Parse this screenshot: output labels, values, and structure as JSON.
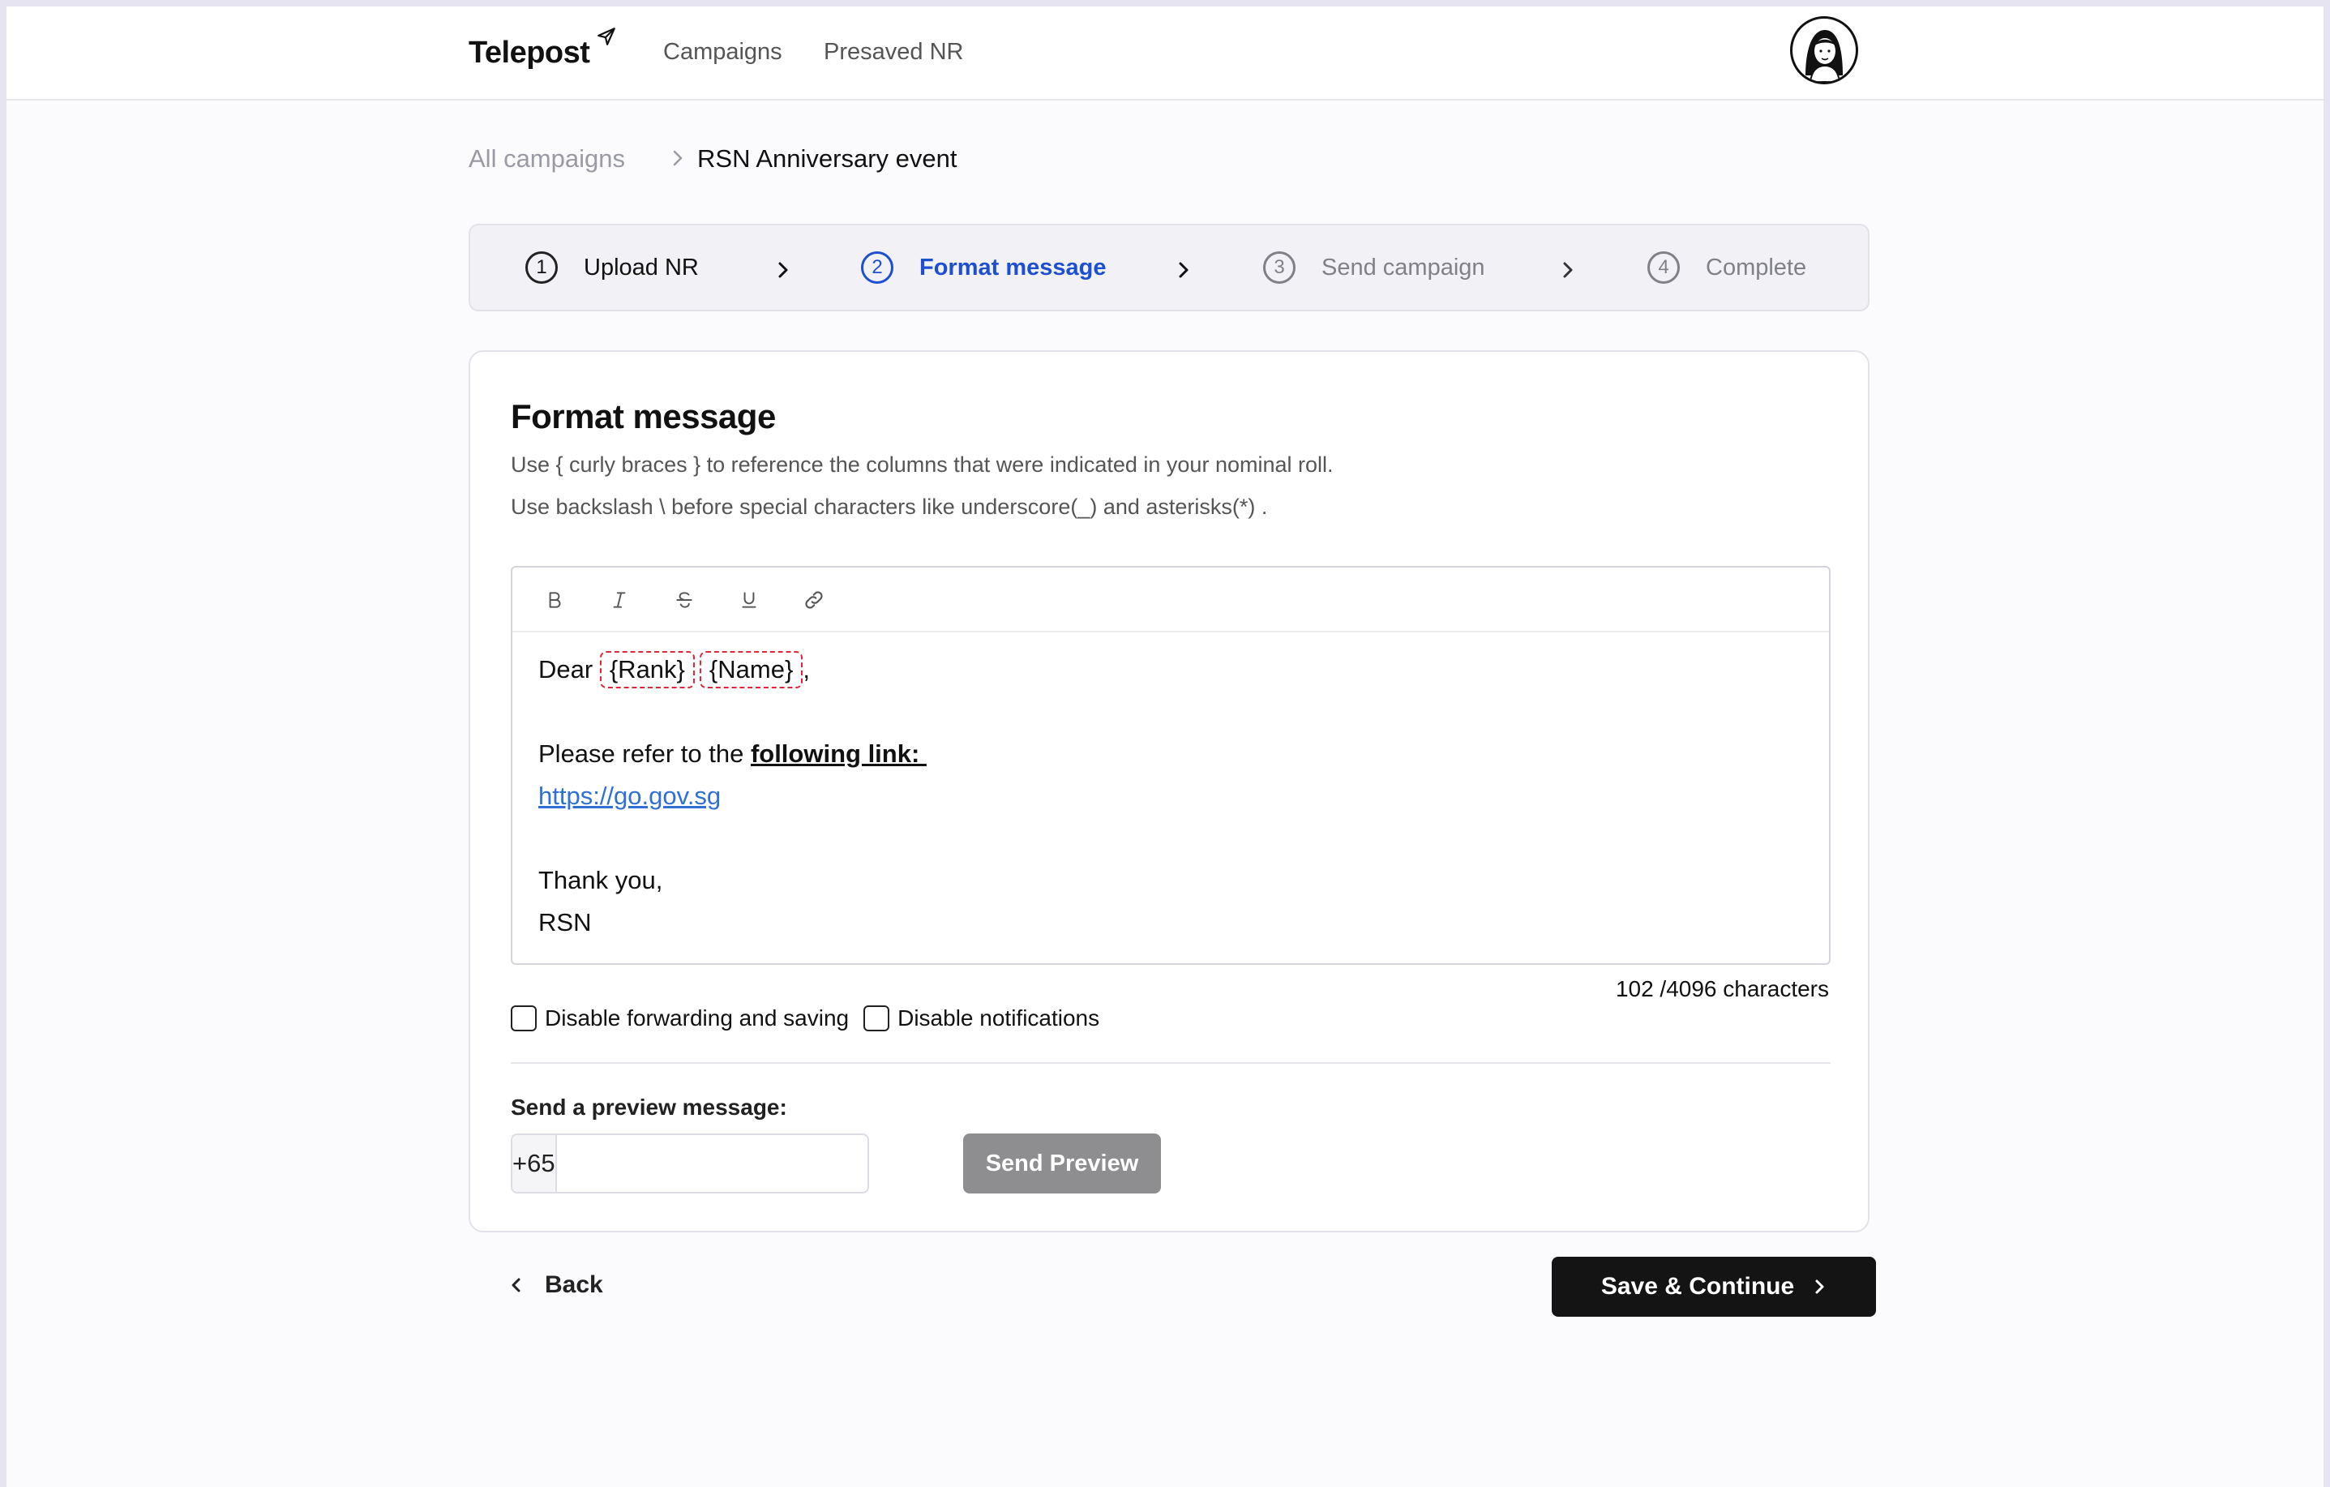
{
  "header": {
    "logo": "Telepost",
    "nav": [
      {
        "label": "Campaigns"
      },
      {
        "label": "Presaved NR"
      }
    ]
  },
  "breadcrumb": {
    "root": "All campaigns",
    "current": "RSN Anniversary event"
  },
  "steps": [
    {
      "num": "1",
      "label": "Upload NR",
      "state": "done"
    },
    {
      "num": "2",
      "label": "Format message",
      "state": "active"
    },
    {
      "num": "3",
      "label": "Send campaign",
      "state": "todo"
    },
    {
      "num": "4",
      "label": "Complete",
      "state": "todo"
    }
  ],
  "card": {
    "title": "Format message",
    "hint1": "Use { curly braces } to reference the columns that were indicated in your nominal roll.",
    "hint2": "Use backslash \\ before special characters like underscore(_) and asterisks(*) ."
  },
  "editor": {
    "toolbar": [
      "bold-icon",
      "italic-icon",
      "strikethrough-icon",
      "underline-icon",
      "link-icon"
    ],
    "greeting": "Dear",
    "tag_rank": "{Rank}",
    "tag_name": "{Name}",
    "comma": ",",
    "refer_text": "Please refer to the ",
    "refer_bold": "following link: ",
    "url": "https://go.gov.sg",
    "thanks": "Thank you,",
    "signoff": "RSN"
  },
  "char_count": "102 /4096 characters",
  "options": {
    "disable_forwarding": "Disable forwarding and saving",
    "disable_notifications": "Disable notifications"
  },
  "preview": {
    "label": "Send a preview message:",
    "prefix": "+65",
    "phone_value": "",
    "button": "Send Preview"
  },
  "footer": {
    "back": "Back",
    "save": "Save & Continue"
  },
  "colors": {
    "accent": "#1f4fd1",
    "tag_border": "#e0263a",
    "link": "#2f6fd6",
    "primary_button": "#141414",
    "disabled_button": "#8e8e90"
  }
}
